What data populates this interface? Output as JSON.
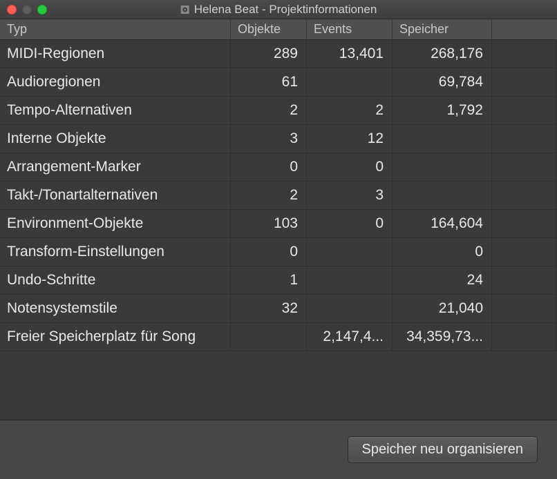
{
  "window": {
    "title": "Helena Beat - Projektinformationen"
  },
  "headers": {
    "typ": "Typ",
    "objekte": "Objekte",
    "events": "Events",
    "speicher": "Speicher"
  },
  "rows": [
    {
      "typ": "MIDI-Regionen",
      "objekte": "289",
      "events": "13,401",
      "speicher": "268,176"
    },
    {
      "typ": "Audioregionen",
      "objekte": "61",
      "events": "",
      "speicher": "69,784"
    },
    {
      "typ": "Tempo-Alternativen",
      "objekte": "2",
      "events": "2",
      "speicher": "1,792"
    },
    {
      "typ": "Interne Objekte",
      "objekte": "3",
      "events": "12",
      "speicher": ""
    },
    {
      "typ": "Arrangement-Marker",
      "objekte": "0",
      "events": "0",
      "speicher": ""
    },
    {
      "typ": "Takt-/Tonartalternativen",
      "objekte": "2",
      "events": "3",
      "speicher": ""
    },
    {
      "typ": "Environment-Objekte",
      "objekte": "103",
      "events": "0",
      "speicher": "164,604"
    },
    {
      "typ": "Transform-Einstellungen",
      "objekte": "0",
      "events": "",
      "speicher": "0"
    },
    {
      "typ": "Undo-Schritte",
      "objekte": "1",
      "events": "",
      "speicher": "24"
    },
    {
      "typ": "Notensystemstile",
      "objekte": "32",
      "events": "",
      "speicher": "21,040"
    },
    {
      "typ": "Freier Speicherplatz für Song",
      "objekte": "",
      "events": "2,147,4...",
      "speicher": "34,359,73..."
    }
  ],
  "footer": {
    "reorganize": "Speicher neu organisieren"
  }
}
